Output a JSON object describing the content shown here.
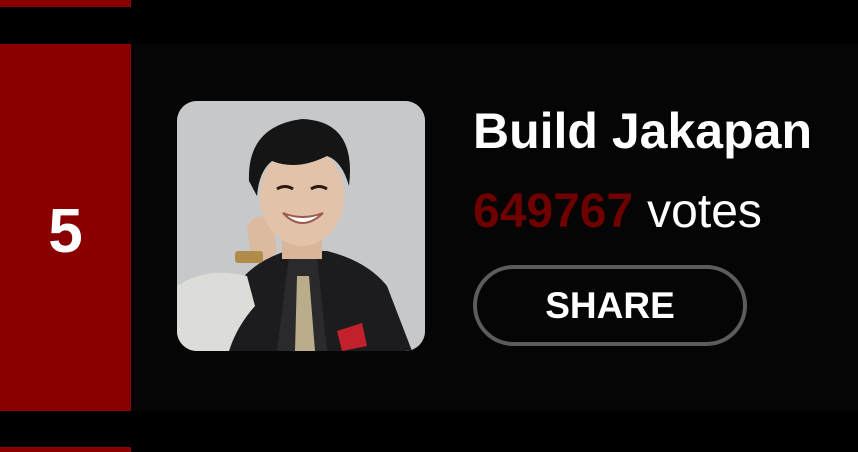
{
  "entry": {
    "rank": "5",
    "name": "Build Jakapan",
    "vote_count": "649767",
    "vote_unit": "votes",
    "share_label": "SHARE",
    "photo_alt": "Build Jakapan"
  },
  "colors": {
    "accent": "#8a0000",
    "vote_count": "#6e0000",
    "background": "#000000",
    "share_border": "#5c5c5c"
  }
}
